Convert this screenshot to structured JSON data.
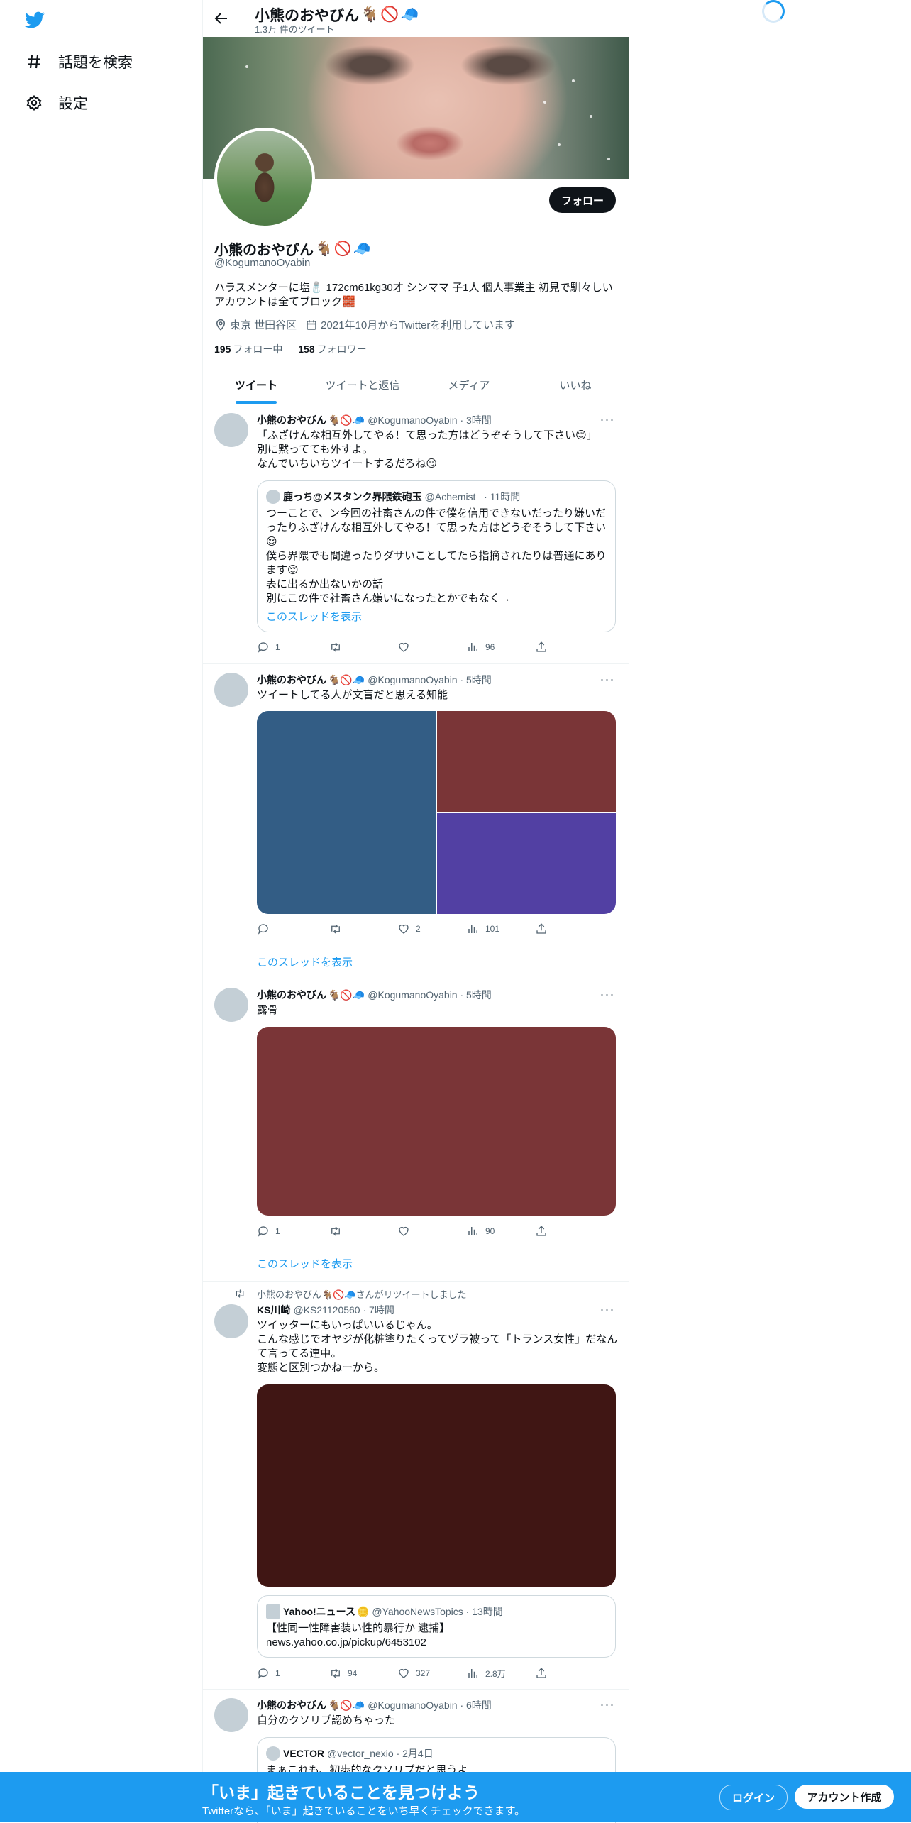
{
  "sidebar": {
    "items": [
      {
        "label": "話題を検索",
        "icon": "hashtag-icon"
      },
      {
        "label": "設定",
        "icon": "gear-icon"
      }
    ]
  },
  "header": {
    "name": "小熊のおやびん",
    "tweet_count": "1.3万 件のツイート"
  },
  "profile": {
    "name": "小熊のおやびん",
    "handle": "@KogumanoOyabin",
    "bio": "ハラスメンターに塩🧂 172cm61kg30才 シンママ 子1人 個人事業主 初見で馴々しいアカウントは全てブロック🧱",
    "location": "東京 世田谷区",
    "joined": "2021年10月からTwitterを利用しています",
    "following_count": "195",
    "following_label": "フォロー中",
    "followers_count": "158",
    "followers_label": "フォロワー",
    "follow_button": "フォロー"
  },
  "tabs": [
    {
      "label": "ツイート",
      "active": true
    },
    {
      "label": "ツイートと返信",
      "active": false
    },
    {
      "label": "メディア",
      "active": false
    },
    {
      "label": "いいね",
      "active": false
    }
  ],
  "tweets": [
    {
      "name": "小熊のおやびん",
      "meta": "@KogumanoOyabin · 3時間",
      "text": "「ふざけんな相互外してやる！て思った方はどうぞそうして下さい😌」\n別に黙ってても外すよ。\nなんでいちいちツイートするだろね😏",
      "quote": {
        "name": "鹿っち@メスタンク界隈鉄砲玉",
        "meta": "@Achemist_ · 11時間",
        "text": "つーことで、ン今回の社畜さんの件で僕を信用できないだったり嫌いだったりふざけんな相互外してやる！て思った方はどうぞそうして下さい😌\n僕ら界隈でも間違ったりダサいことしてたら指摘されたりは普通にあります😌\n表に出るか出ないかの話\n別にこの件で社畜さん嫌いになったとかでもなく→",
        "thread_link": "このスレッドを表示"
      },
      "replies": "1",
      "retweets": "",
      "likes": "",
      "views": "96"
    },
    {
      "name": "小熊のおやびん",
      "meta": "@KogumanoOyabin · 5時間",
      "text": "ツイートしてる人が文盲だと思える知能",
      "media_colors": [
        "#335d85",
        "#7a3537",
        "#5240a3"
      ],
      "replies": "",
      "retweets": "",
      "likes": "2",
      "views": "101",
      "thread_link": "このスレッドを表示"
    },
    {
      "name": "小熊のおやびん",
      "meta": "@KogumanoOyabin · 5時間",
      "text": "露骨",
      "media_colors": [
        "#7a3537"
      ],
      "replies": "1",
      "retweets": "",
      "likes": "",
      "views": "90",
      "thread_link": "このスレッドを表示"
    },
    {
      "retweeted_by": "小熊のおやびん🐐🚫🧢さんがリツイートしました",
      "name": "KS川崎",
      "meta": "@KS21120560 · 7時間",
      "text": "ツイッターにもいっぱいいるじゃん。\nこんな感じでオヤジが化粧塗りたくってヅラ被って「トランス女性」だなんて言ってる連中。\n変態と区別つかねーから。",
      "media_colors": [
        "#401614"
      ],
      "quote": {
        "name": "Yahoo!ニュース",
        "meta": "@YahooNewsTopics · 13時間",
        "text": "【性同一性障害装い性的暴行か 逮捕】\nnews.yahoo.co.jp/pickup/6453102"
      },
      "replies": "1",
      "retweets": "94",
      "likes": "327",
      "views": "2.8万"
    },
    {
      "name": "小熊のおやびん",
      "meta": "@KogumanoOyabin · 6時間",
      "text": "自分のクソリプ認めちゃった",
      "quote": {
        "name": "VECTOR",
        "meta": "@vector_nexio · 2月4日",
        "text": "まぁこれも、初歩的なクソリプだと思うよ"
      }
    }
  ],
  "bottom_bar": {
    "title": "「いま」起きていることを見つけよう",
    "subtitle": "Twitterなら、「いま」起きていることをいち早くチェックできます。",
    "login": "ログイン",
    "signup": "アカウント作成"
  },
  "colors": {
    "accent": "#1d9bf0",
    "text": "#0f1419",
    "muted": "#536471"
  }
}
